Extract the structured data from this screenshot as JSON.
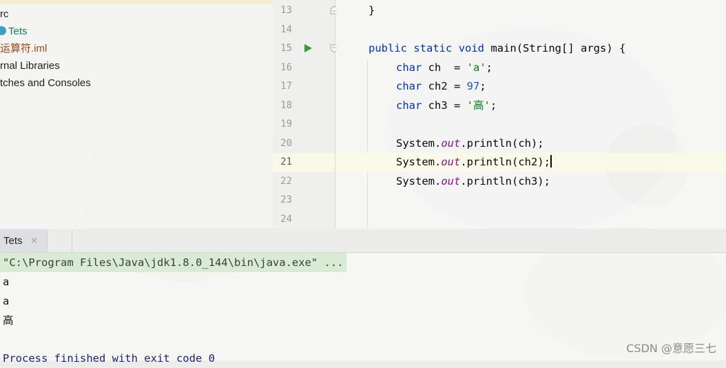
{
  "project_tree": {
    "items": [
      {
        "label": "rc",
        "kind": "folder"
      },
      {
        "label": "Tets",
        "kind": "class",
        "icon": "class-icon"
      },
      {
        "label": "运算符.iml",
        "kind": "iml"
      },
      {
        "label": "rnal Libraries",
        "kind": "libraries"
      },
      {
        "label": "tches and Consoles",
        "kind": "scratches"
      }
    ]
  },
  "editor": {
    "line_numbers": [
      "13",
      "14",
      "15",
      "16",
      "17",
      "18",
      "19",
      "20",
      "21",
      "22",
      "23",
      "24"
    ],
    "current_line": "21",
    "run_gutter_line": "15",
    "lines": {
      "l13": {
        "brace": "}"
      },
      "l15": {
        "kw_public": "public",
        "kw_static": "static",
        "kw_void": "void",
        "method": "main",
        "params": "(String[] args) {"
      },
      "l16": {
        "type": "char",
        "decl": " ch  = ",
        "value": "'a'",
        "end": ";"
      },
      "l17": {
        "type": "char",
        "decl": " ch2 = ",
        "value": "97",
        "end": ";"
      },
      "l18": {
        "type": "char",
        "decl": " ch3 = ",
        "value": "'高'",
        "end": ";"
      },
      "l20": {
        "obj": "System.",
        "field": "out",
        "call": ".println(ch);"
      },
      "l21": {
        "obj": "System.",
        "field": "out",
        "call": ".println(ch2);"
      },
      "l22": {
        "obj": "System.",
        "field": "out",
        "call": ".println(ch3);"
      }
    }
  },
  "run_panel": {
    "tab_label": "Tets",
    "close_glyph": "×",
    "console": {
      "command": "\"C:\\Program Files\\Java\\jdk1.8.0_144\\bin\\java.exe\" ...",
      "output": [
        "a",
        "a",
        "高"
      ],
      "exit_message": "Process finished with exit code 0"
    }
  },
  "watermark": "CSDN @意愿三七",
  "colors": {
    "keyword": "#0033b3",
    "string": "#067d17",
    "number": "#1750eb",
    "static_field": "#871094",
    "run_icon": "#3b9a39",
    "class_name": "#15805e"
  }
}
